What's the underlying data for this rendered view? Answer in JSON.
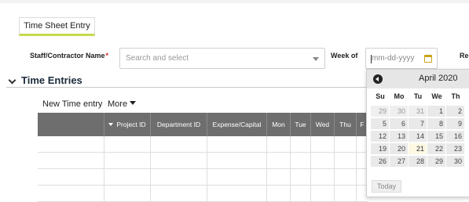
{
  "tabs": [
    {
      "label": "Time Sheet Entry",
      "active": true
    }
  ],
  "form": {
    "staff_label": "Staff/Contractor Name",
    "required_mark": "*",
    "staff_placeholder": "Search and select",
    "week_label": "Week of",
    "date_placeholder": "mm-dd-yyyy",
    "truncated_label": "Re"
  },
  "section": {
    "title": "Time Entries"
  },
  "toolbar": {
    "new_label": "New Time entry",
    "more_label": "More"
  },
  "table": {
    "columns": [
      "",
      "Project ID",
      "Department ID",
      "Expense/Capital",
      "Mon",
      "Tue",
      "Wed",
      "Thu",
      "F"
    ],
    "sorted_column": "Project ID",
    "empty_rows": 4
  },
  "calendar": {
    "title": "April 2020",
    "weekday_headers": [
      "Su",
      "Mo",
      "Tu",
      "We",
      "Th"
    ],
    "weeks": [
      [
        "29",
        "30",
        "31",
        "1",
        "2"
      ],
      [
        "5",
        "6",
        "7",
        "8",
        "9"
      ],
      [
        "12",
        "13",
        "14",
        "15",
        "16"
      ],
      [
        "19",
        "20",
        "21",
        "22",
        "23"
      ],
      [
        "26",
        "27",
        "28",
        "29",
        "30"
      ]
    ],
    "muted_days": [
      "29",
      "30",
      "31"
    ],
    "today": "21",
    "today_button": "Today"
  },
  "colors": {
    "tab_underline": "#c8d84f",
    "header_gray": "#6e6e6e",
    "required_red": "#dd2222",
    "today_highlight": "#fcf8e3"
  }
}
